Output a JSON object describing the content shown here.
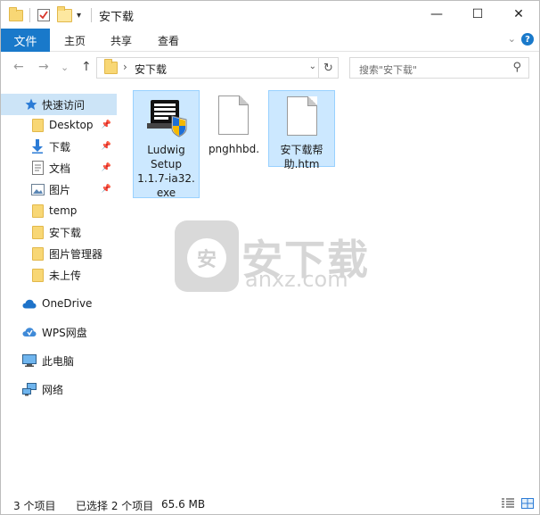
{
  "titlebar": {
    "title": "安下载",
    "dropdown_glyph": "▾",
    "minimize": "—",
    "maximize": "☐",
    "close": "✕"
  },
  "ribbon": {
    "tabs": [
      "文件",
      "主页",
      "共享",
      "查看"
    ],
    "expand_glyph": "⌄",
    "help": "?"
  },
  "navbar": {
    "back": "←",
    "forward": "→",
    "recent": "⌄",
    "up": "↑",
    "path_separator": "›",
    "address": "安下载",
    "refresh": "↻",
    "search_placeholder": "搜索\"安下载\"",
    "search_icon": "⚲"
  },
  "sidebar": {
    "quick_access": "快速访问",
    "pinned": [
      {
        "label": "Desktop",
        "icon": "folder-icon",
        "pinned": true
      },
      {
        "label": "下载",
        "icon": "download-icon",
        "pinned": true
      },
      {
        "label": "文档",
        "icon": "document-icon",
        "pinned": true
      },
      {
        "label": "图片",
        "icon": "pictures-icon",
        "pinned": true
      }
    ],
    "folders": [
      "temp",
      "安下载",
      "图片管理器",
      "未上传"
    ],
    "onedrive": "OneDrive",
    "wps": "WPS网盘",
    "this_pc": "此电脑",
    "network": "网络"
  },
  "files": [
    {
      "name_lines": [
        "Ludwig",
        "Setup",
        "1.1.7-ia32.",
        "exe"
      ],
      "type": "installer-exe",
      "selected": true
    },
    {
      "name_lines": [
        "pnghhbd."
      ],
      "type": "blank-file",
      "selected": false
    },
    {
      "name_lines": [
        "安下载帮",
        "助.htm"
      ],
      "type": "blank-file",
      "selected": true
    }
  ],
  "watermark": {
    "badge_glyph": "安",
    "cn": "安下载",
    "en": "anxz.com"
  },
  "status": {
    "count": "3 个项目",
    "selection": "已选择 2 个项目",
    "size": "65.6 MB"
  }
}
